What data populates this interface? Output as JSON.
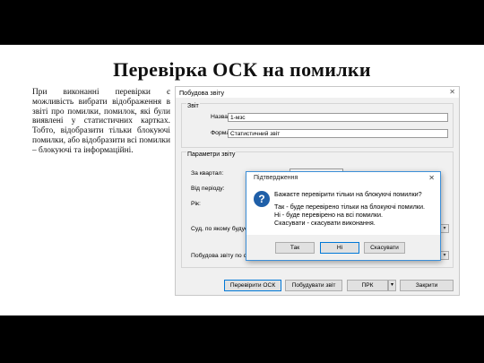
{
  "slide": {
    "title": "Перевірка ОСК на помилки",
    "paragraph": "При виконанні перевірки є можливість вибрати відображення в звіті про помилки, помилок, які були виявлені у статистичних картках. Тобто, відобразити тільки блокуючі помилки, або відобразити всі помилки – блокуючі та інформаційні."
  },
  "window": {
    "title": "Побудова звіту",
    "close_glyph": "✕",
    "report_group": {
      "label": "Звіт",
      "name_label": "Назва звіту:",
      "name_value": "1-мзс",
      "form_label": "Форма звіту:",
      "form_value": "Статистичний звіт"
    },
    "params_group": {
      "label": "Параметри звіту",
      "quarter_label": "За квартал:",
      "period_label": "Від періоду:",
      "year_label": "Рік:",
      "court_label": "Суд, по якому будує",
      "build_label": "Побудова звіту по с"
    },
    "buttons": {
      "check": "Перевірити ОСК",
      "build": "Побудувати звіт",
      "prk": "ПРК",
      "close": "Закрити"
    }
  },
  "dialog": {
    "title": "Підтвердження",
    "close_glyph": "✕",
    "icon": "question-icon",
    "icon_glyph": "?",
    "question": "Бажаєте перевірити тільки на блокуючі помилки?",
    "line1": "Так - буде перевірено тільки на блокуючі помилки.",
    "line2": "Ні - буде перевірено на всі помилки.",
    "line3": "Скасувати - скасувати виконання.",
    "buttons": {
      "yes": "Так",
      "no": "Ні",
      "cancel": "Скасувати"
    }
  }
}
